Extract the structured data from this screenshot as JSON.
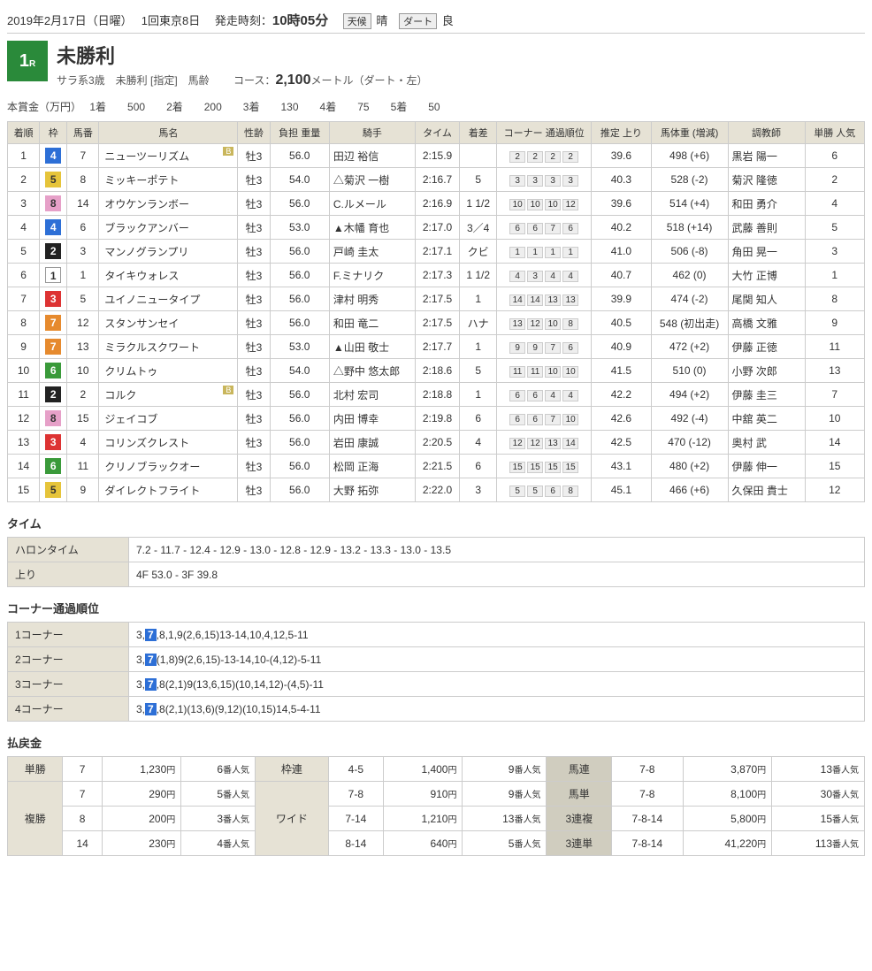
{
  "header": {
    "date": "2019年2月17日（日曜）",
    "meet": "1回東京8日",
    "start_label": "発走時刻：",
    "start_time": "10時05分",
    "weather_label": "天候",
    "weather": "晴",
    "track_label": "ダート",
    "track_cond": "良"
  },
  "race": {
    "num": "1",
    "num_suffix": "R",
    "title": "未勝利",
    "sub1": "サラ系3歳　未勝利  [指定]　馬齢",
    "course_label": "コース：",
    "distance": "2,100",
    "course_suffix": "メートル（ダート・左）"
  },
  "prize": {
    "label": "本賞金（万円）",
    "items": [
      {
        "place": "1着",
        "amt": "500"
      },
      {
        "place": "2着",
        "amt": "200"
      },
      {
        "place": "3着",
        "amt": "130"
      },
      {
        "place": "4着",
        "amt": "75"
      },
      {
        "place": "5着",
        "amt": "50"
      }
    ]
  },
  "cols": {
    "rank": "着順",
    "waku": "枠",
    "num": "馬番",
    "name": "馬名",
    "sexage": "性齢",
    "weight": "負担\n重量",
    "jockey": "騎手",
    "time": "タイム",
    "margin": "着差",
    "corner": "コーナー\n通過順位",
    "last": "推定\n上り",
    "bweight": "馬体重\n(増減)",
    "trainer": "調教師",
    "pop": "単勝\n人気"
  },
  "rows": [
    {
      "rank": "1",
      "waku": "4",
      "num": "7",
      "name": "ニューツーリズム",
      "badge": "B",
      "sexage": "牡3",
      "wt": "56.0",
      "jockey": "田辺 裕信",
      "time": "2:15.9",
      "margin": "",
      "corner": [
        "2",
        "2",
        "2",
        "2"
      ],
      "last": "39.6",
      "bw": "498 (+6)",
      "trainer": "黒岩 陽一",
      "pop": "6"
    },
    {
      "rank": "2",
      "waku": "5",
      "num": "8",
      "name": "ミッキーポテト",
      "badge": "",
      "sexage": "牡3",
      "wt": "54.0",
      "jockey": "△菊沢 一樹",
      "time": "2:16.7",
      "margin": "5",
      "corner": [
        "3",
        "3",
        "3",
        "3"
      ],
      "last": "40.3",
      "bw": "528 (-2)",
      "trainer": "菊沢 隆徳",
      "pop": "2"
    },
    {
      "rank": "3",
      "waku": "8",
      "num": "14",
      "name": "オウケンランボー",
      "badge": "",
      "sexage": "牡3",
      "wt": "56.0",
      "jockey": "C.ルメール",
      "time": "2:16.9",
      "margin": "1 1/2",
      "corner": [
        "10",
        "10",
        "10",
        "12"
      ],
      "last": "39.6",
      "bw": "514 (+4)",
      "trainer": "和田 勇介",
      "pop": "4"
    },
    {
      "rank": "4",
      "waku": "4",
      "num": "6",
      "name": "ブラックアンバー",
      "badge": "",
      "sexage": "牡3",
      "wt": "53.0",
      "jockey": "▲木幡 育也",
      "time": "2:17.0",
      "margin": "3／4",
      "corner": [
        "6",
        "6",
        "7",
        "6"
      ],
      "last": "40.2",
      "bw": "518 (+14)",
      "trainer": "武藤 善則",
      "pop": "5"
    },
    {
      "rank": "5",
      "waku": "2",
      "num": "3",
      "name": "マンノグランプリ",
      "badge": "",
      "sexage": "牡3",
      "wt": "56.0",
      "jockey": "戸崎 圭太",
      "time": "2:17.1",
      "margin": "クビ",
      "corner": [
        "1",
        "1",
        "1",
        "1"
      ],
      "last": "41.0",
      "bw": "506 (-8)",
      "trainer": "角田 晃一",
      "pop": "3"
    },
    {
      "rank": "6",
      "waku": "1",
      "num": "1",
      "name": "タイキウォレス",
      "badge": "",
      "sexage": "牡3",
      "wt": "56.0",
      "jockey": "F.ミナリク",
      "time": "2:17.3",
      "margin": "1 1/2",
      "corner": [
        "4",
        "3",
        "4",
        "4"
      ],
      "last": "40.7",
      "bw": "462 (0)",
      "trainer": "大竹 正博",
      "pop": "1"
    },
    {
      "rank": "7",
      "waku": "3",
      "num": "5",
      "name": "ユイノニュータイプ",
      "badge": "",
      "sexage": "牡3",
      "wt": "56.0",
      "jockey": "津村 明秀",
      "time": "2:17.5",
      "margin": "1",
      "corner": [
        "14",
        "14",
        "13",
        "13"
      ],
      "last": "39.9",
      "bw": "474 (-2)",
      "trainer": "尾関 知人",
      "pop": "8"
    },
    {
      "rank": "8",
      "waku": "7",
      "num": "12",
      "name": "スタンサンセイ",
      "badge": "",
      "sexage": "牡3",
      "wt": "56.0",
      "jockey": "和田 竜二",
      "time": "2:17.5",
      "margin": "ハナ",
      "corner": [
        "13",
        "12",
        "10",
        "8"
      ],
      "last": "40.5",
      "bw": "548 (初出走)",
      "trainer": "高橋 文雅",
      "pop": "9"
    },
    {
      "rank": "9",
      "waku": "7",
      "num": "13",
      "name": "ミラクルスクワート",
      "badge": "",
      "sexage": "牡3",
      "wt": "53.0",
      "jockey": "▲山田 敬士",
      "time": "2:17.7",
      "margin": "1",
      "corner": [
        "9",
        "9",
        "7",
        "6"
      ],
      "last": "40.9",
      "bw": "472 (+2)",
      "trainer": "伊藤 正徳",
      "pop": "11"
    },
    {
      "rank": "10",
      "waku": "6",
      "num": "10",
      "name": "クリムトゥ",
      "badge": "",
      "sexage": "牡3",
      "wt": "54.0",
      "jockey": "△野中 悠太郎",
      "time": "2:18.6",
      "margin": "5",
      "corner": [
        "11",
        "11",
        "10",
        "10"
      ],
      "last": "41.5",
      "bw": "510 (0)",
      "trainer": "小野 次郎",
      "pop": "13"
    },
    {
      "rank": "11",
      "waku": "2",
      "num": "2",
      "name": "コルク",
      "badge": "B",
      "sexage": "牡3",
      "wt": "56.0",
      "jockey": "北村 宏司",
      "time": "2:18.8",
      "margin": "1",
      "corner": [
        "6",
        "6",
        "4",
        "4"
      ],
      "last": "42.2",
      "bw": "494 (+2)",
      "trainer": "伊藤 圭三",
      "pop": "7"
    },
    {
      "rank": "12",
      "waku": "8",
      "num": "15",
      "name": "ジェイコブ",
      "badge": "",
      "sexage": "牡3",
      "wt": "56.0",
      "jockey": "内田 博幸",
      "time": "2:19.8",
      "margin": "6",
      "corner": [
        "6",
        "6",
        "7",
        "10"
      ],
      "last": "42.6",
      "bw": "492 (-4)",
      "trainer": "中舘 英二",
      "pop": "10"
    },
    {
      "rank": "13",
      "waku": "3",
      "num": "4",
      "name": "コリンズクレスト",
      "badge": "",
      "sexage": "牡3",
      "wt": "56.0",
      "jockey": "岩田 康誠",
      "time": "2:20.5",
      "margin": "4",
      "corner": [
        "12",
        "12",
        "13",
        "14"
      ],
      "last": "42.5",
      "bw": "470 (-12)",
      "trainer": "奥村 武",
      "pop": "14"
    },
    {
      "rank": "14",
      "waku": "6",
      "num": "11",
      "name": "クリノブラックオー",
      "badge": "",
      "sexage": "牡3",
      "wt": "56.0",
      "jockey": "松岡 正海",
      "time": "2:21.5",
      "margin": "6",
      "corner": [
        "15",
        "15",
        "15",
        "15"
      ],
      "last": "43.1",
      "bw": "480 (+2)",
      "trainer": "伊藤 伸一",
      "pop": "15"
    },
    {
      "rank": "15",
      "waku": "5",
      "num": "9",
      "name": "ダイレクトフライト",
      "badge": "",
      "sexage": "牡3",
      "wt": "56.0",
      "jockey": "大野 拓弥",
      "time": "2:22.0",
      "margin": "3",
      "corner": [
        "5",
        "5",
        "6",
        "8"
      ],
      "last": "45.1",
      "bw": "466 (+6)",
      "trainer": "久保田 貴士",
      "pop": "12"
    }
  ],
  "time_section": {
    "title": "タイム",
    "furlong_label": "ハロンタイム",
    "furlong": "7.2 - 11.7 - 12.4 - 12.9 - 13.0 - 12.8 - 12.9 - 13.2 - 13.3 - 13.0 - 13.5",
    "agari_label": "上り",
    "agari": "4F 53.0 - 3F 39.8"
  },
  "corner_section": {
    "title": "コーナー通過順位",
    "rows": [
      {
        "label": "1コーナー",
        "pre": "3,",
        "hl": "7",
        "post": ",8,1,9(2,6,15)13-14,10,4,12,5-11"
      },
      {
        "label": "2コーナー",
        "pre": "3,",
        "hl": "7",
        "post": "(1,8)9(2,6,15)-13-14,10-(4,12)-5-11"
      },
      {
        "label": "3コーナー",
        "pre": "3,",
        "hl": "7",
        "post": ",8(2,1)9(13,6,15)(10,14,12)-(4,5)-11"
      },
      {
        "label": "4コーナー",
        "pre": "3,",
        "hl": "7",
        "post": ",8(2,1)(13,6)(9,12)(10,15)14,5-4-11"
      }
    ]
  },
  "payout_section": {
    "title": "払戻金",
    "labels": {
      "tansho": "単勝",
      "fukusho": "複勝",
      "wakuren": "枠連",
      "wide": "ワイド",
      "umaren": "馬連",
      "umatan": "馬単",
      "renpuku": "3連複",
      "rentan": "3連単",
      "yen": "円",
      "pop": "番人気"
    },
    "tansho": {
      "num": "7",
      "yen": "1,230",
      "pop": "6"
    },
    "fukusho": [
      {
        "num": "7",
        "yen": "290",
        "pop": "5"
      },
      {
        "num": "8",
        "yen": "200",
        "pop": "3"
      },
      {
        "num": "14",
        "yen": "230",
        "pop": "4"
      }
    ],
    "wakuren": {
      "combo": "4-5",
      "yen": "1,400",
      "pop": "9"
    },
    "wide": [
      {
        "combo": "7-8",
        "yen": "910",
        "pop": "9"
      },
      {
        "combo": "7-14",
        "yen": "1,210",
        "pop": "13"
      },
      {
        "combo": "8-14",
        "yen": "640",
        "pop": "5"
      }
    ],
    "umaren": {
      "combo": "7-8",
      "yen": "3,870",
      "pop": "13"
    },
    "umatan": {
      "combo": "7-8",
      "yen": "8,100",
      "pop": "30"
    },
    "renpuku": {
      "combo": "7-8-14",
      "yen": "5,800",
      "pop": "15"
    },
    "rentan": {
      "combo": "7-8-14",
      "yen": "41,220",
      "pop": "113"
    }
  }
}
